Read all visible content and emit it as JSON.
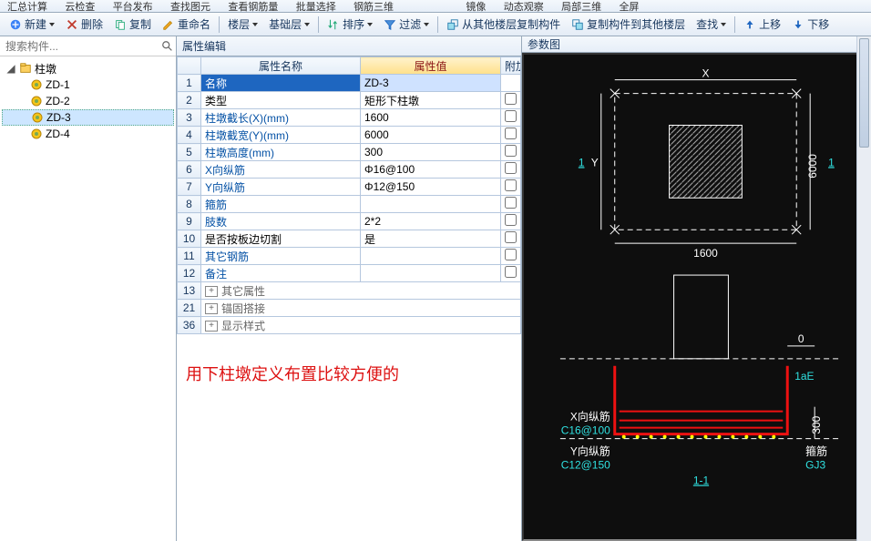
{
  "ribbon_fragments": [
    "汇总计算",
    "云检查",
    "平台发布",
    "查找图元",
    "查看钢筋量",
    "批量选择",
    "钢筋三维",
    "镜像",
    "动态观察",
    "局部三维",
    "全屏"
  ],
  "toolbar": {
    "new": "新建",
    "del": "删除",
    "copy": "复制",
    "rename": "重命名",
    "floor": "楼层",
    "base": "基础层",
    "sort": "排序",
    "filter": "过滤",
    "copy_from": "从其他楼层复制构件",
    "copy_to": "复制构件到其他楼层",
    "find": "查找",
    "up": "上移",
    "down": "下移"
  },
  "left": {
    "search_placeholder": "搜索构件...",
    "root": "柱墩",
    "children": [
      {
        "label": "ZD-1",
        "selected": false
      },
      {
        "label": "ZD-2",
        "selected": false
      },
      {
        "label": "ZD-3",
        "selected": true
      },
      {
        "label": "ZD-4",
        "selected": false
      }
    ]
  },
  "props": {
    "tab": "属性编辑",
    "headers": {
      "name": "属性名称",
      "value": "属性值",
      "attach": "附加"
    },
    "rows": [
      {
        "n": "1",
        "name": "名称",
        "value": "ZD-3",
        "sel": true,
        "link": false
      },
      {
        "n": "2",
        "name": "类型",
        "value": "矩形下柱墩",
        "link": false
      },
      {
        "n": "3",
        "name": "柱墩截长(X)(mm)",
        "value": "1600",
        "link": true
      },
      {
        "n": "4",
        "name": "柱墩截宽(Y)(mm)",
        "value": "6000",
        "link": true
      },
      {
        "n": "5",
        "name": "柱墩高度(mm)",
        "value": "300",
        "link": true
      },
      {
        "n": "6",
        "name": "X向纵筋",
        "value": "Φ16@100",
        "link": true
      },
      {
        "n": "7",
        "name": "Y向纵筋",
        "value": "Φ12@150",
        "link": true
      },
      {
        "n": "8",
        "name": "箍筋",
        "value": "",
        "link": true
      },
      {
        "n": "9",
        "name": "肢数",
        "value": "2*2",
        "link": true
      },
      {
        "n": "10",
        "name": "是否按板边切割",
        "value": "是",
        "link": false
      },
      {
        "n": "11",
        "name": "其它钢筋",
        "value": "",
        "link": true
      },
      {
        "n": "12",
        "name": "备注",
        "value": "",
        "link": true
      }
    ],
    "groups": [
      {
        "n": "13",
        "name": "其它属性"
      },
      {
        "n": "21",
        "name": "锚固搭接"
      },
      {
        "n": "36",
        "name": "显示样式"
      }
    ]
  },
  "note": "用下柱墩定义布置比较方便的",
  "right_title": "参数图",
  "diagram": {
    "top": {
      "x_label": "X",
      "y_label": "Y",
      "len": "1600",
      "wid": "6000",
      "sec1": "1",
      "sec1b": "1"
    },
    "bottom": {
      "zero": "0",
      "lae": "1aE",
      "x_rebar": "X向纵筋",
      "x_spec": "C16@100",
      "y_rebar": "Y向纵筋",
      "y_spec": "C12@150",
      "stirrup": "箍筋",
      "gj": "GJ3",
      "sec": "1-1",
      "h": "300"
    }
  }
}
